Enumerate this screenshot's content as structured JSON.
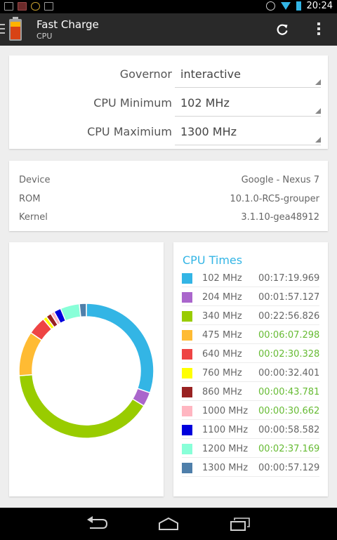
{
  "status_bar": {
    "time": "20:24"
  },
  "action_bar": {
    "title": "Fast Charge",
    "subtitle": "CPU"
  },
  "governor_card": {
    "governor": {
      "label": "Governor",
      "value": "interactive"
    },
    "cpu_min": {
      "label": "CPU Minimum",
      "value": "102 MHz"
    },
    "cpu_max": {
      "label": "CPU Maximium",
      "value": "1300 MHz"
    }
  },
  "device_info": {
    "device": {
      "label": "Device",
      "value": "Google - Nexus 7"
    },
    "rom": {
      "label": "ROM",
      "value": "10.1.0-RC5-grouper"
    },
    "kernel": {
      "label": "Kernel",
      "value": "3.1.10-gea48912"
    }
  },
  "cpu_times": {
    "title": "CPU Times",
    "highlight_color": "#66bb33",
    "items": [
      {
        "freq": "102 MHz",
        "time": "00:17:19.969",
        "color": "#33b5e5",
        "highlight": false
      },
      {
        "freq": "204 MHz",
        "time": "00:01:57.127",
        "color": "#aa66cc",
        "highlight": false
      },
      {
        "freq": "340 MHz",
        "time": "00:22:56.826",
        "color": "#99cc00",
        "highlight": false
      },
      {
        "freq": "475 MHz",
        "time": "00:06:07.298",
        "color": "#ffbb33",
        "highlight": true
      },
      {
        "freq": "640 MHz",
        "time": "00:02:30.328",
        "color": "#ee4444",
        "highlight": true
      },
      {
        "freq": "760 MHz",
        "time": "00:00:32.401",
        "color": "#ffff00",
        "highlight": false
      },
      {
        "freq": "860 MHz",
        "time": "00:00:43.781",
        "color": "#992222",
        "highlight": true
      },
      {
        "freq": "1000 MHz",
        "time": "00:00:30.662",
        "color": "#ffb6c1",
        "highlight": true
      },
      {
        "freq": "1100 MHz",
        "time": "00:00:58.582",
        "color": "#0000dd",
        "highlight": false
      },
      {
        "freq": "1200 MHz",
        "time": "00:02:37.169",
        "color": "#88ffd8",
        "highlight": true
      },
      {
        "freq": "1300 MHz",
        "time": "00:00:57.129",
        "color": "#4f7faa",
        "highlight": false
      }
    ]
  },
  "chart_data": {
    "type": "pie",
    "style": "donut",
    "categories": [
      "102 MHz",
      "204 MHz",
      "340 MHz",
      "475 MHz",
      "640 MHz",
      "760 MHz",
      "860 MHz",
      "1000 MHz",
      "1100 MHz",
      "1200 MHz",
      "1300 MHz"
    ],
    "values": [
      1039.969,
      117.127,
      1376.826,
      367.298,
      150.328,
      32.401,
      43.781,
      30.662,
      58.582,
      157.169,
      57.129
    ],
    "colors": [
      "#33b5e5",
      "#aa66cc",
      "#99cc00",
      "#ffbb33",
      "#ee4444",
      "#ffff00",
      "#992222",
      "#ffb6c1",
      "#0000dd",
      "#88ffd8",
      "#4f7faa"
    ],
    "start_angle_deg": 0,
    "legend": "right"
  }
}
